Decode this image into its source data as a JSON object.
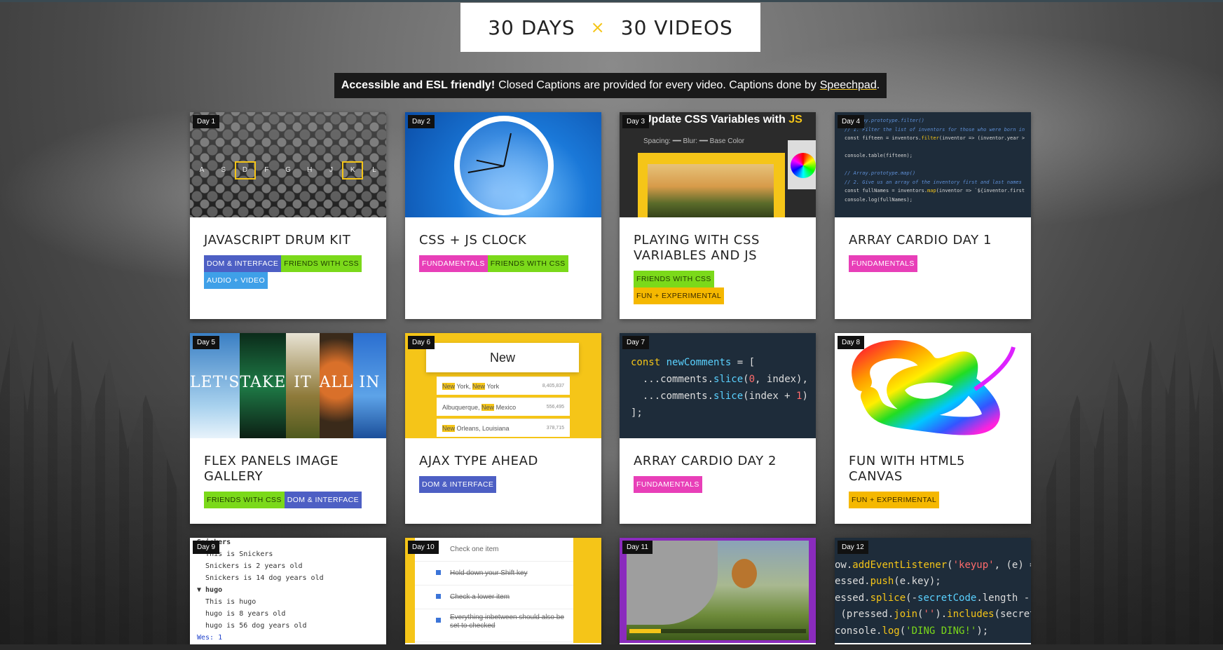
{
  "header": {
    "logo_left": "30 DAYS",
    "logo_sep": "×",
    "logo_right": "30 VIDEOS"
  },
  "banner": {
    "bold": "Accessible and ESL friendly!",
    "text": "Closed Captions are provided for every video. Captions done by",
    "link": "Speechpad",
    "end": "."
  },
  "colors": {
    "accent": "#f5c518",
    "dom": "#4d5fc4",
    "css": "#7bd91a",
    "av": "#3fa0e8",
    "fund": "#e83fb8",
    "fun": "#f5b800"
  },
  "cards": [
    {
      "day": "Day 1",
      "title": "JavaScript Drum Kit",
      "tags": [
        "DOM & Interface",
        "Friends with CSS",
        "Audio + Video"
      ],
      "keys": [
        "A",
        "S",
        "D",
        "F",
        "G",
        "H",
        "J",
        "K",
        "L"
      ]
    },
    {
      "day": "Day 2",
      "title": "CSS + JS Clock",
      "tags": [
        "Fundamentals",
        "Friends with CSS"
      ]
    },
    {
      "day": "Day 3",
      "title": "Playing with CSS Variables and JS",
      "tags": [
        "Friends with CSS",
        "Fun + Experimental"
      ],
      "thumb_title": "Update CSS Variables with",
      "thumb_title_js": "JS",
      "thumb_controls": "Spacing: ━━ Blur: ━━ Base Color"
    },
    {
      "day": "Day 4",
      "title": "Array Cardio Day 1",
      "tags": [
        "Fundamentals"
      ]
    },
    {
      "day": "Day 5",
      "title": "Flex Panels Image Gallery",
      "tags": [
        "Friends with CSS",
        "DOM & Interface"
      ],
      "panels": [
        "LET'S",
        "TAKE",
        "IT",
        "ALL",
        "IN"
      ]
    },
    {
      "day": "Day 6",
      "title": "Ajax Type Ahead",
      "tags": [
        "DOM & Interface"
      ],
      "search": "New",
      "rows": [
        {
          "pre": "New",
          "mid": " York, ",
          "hl": "New",
          "post": " York",
          "pop": "8,405,837"
        },
        {
          "pre": "",
          "mid": "Albuquerque, ",
          "hl": "New",
          "post": " Mexico",
          "pop": "556,495"
        },
        {
          "pre": "New",
          "mid": " Orleans, Louisiana",
          "hl": "",
          "post": "",
          "pop": "378,715"
        }
      ]
    },
    {
      "day": "Day 7",
      "title": "Array Cardio Day 2",
      "tags": [
        "Fundamentals"
      ]
    },
    {
      "day": "Day 8",
      "title": "Fun with HTML5 Canvas",
      "tags": [
        "Fun + Experimental"
      ]
    },
    {
      "day": "Day 9",
      "lines": [
        "Snickers",
        "This is Snickers",
        "Snickers is 2 years old",
        "Snickers is 14 dog years old",
        "▼ hugo",
        "This is hugo",
        "hugo is 8 years old",
        "hugo is 56 dog years old",
        "Wes: 1"
      ]
    },
    {
      "day": "Day 10",
      "items": [
        "Check one item",
        "Hold down your Shift key",
        "Check a lower item",
        "Everything inbetween should also be set to checked"
      ]
    },
    {
      "day": "Day 11"
    },
    {
      "day": "Day 12"
    }
  ]
}
